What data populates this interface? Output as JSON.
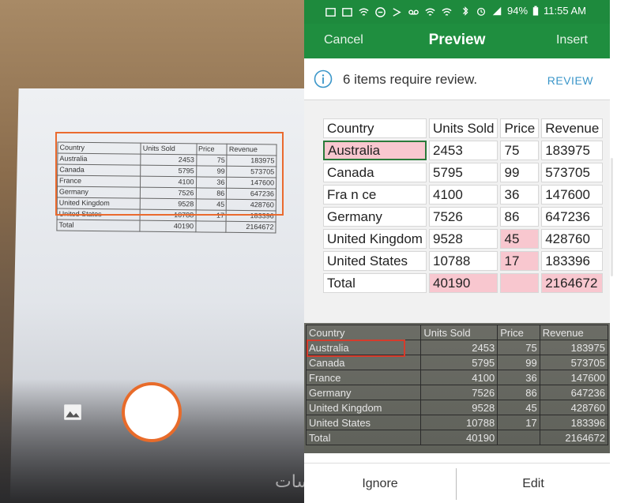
{
  "camera": {
    "paper_table": [
      [
        "Country",
        "Units Sold",
        "Price",
        "Revenue"
      ],
      [
        "Australia",
        "2453",
        "75",
        "183975"
      ],
      [
        "Canada",
        "5795",
        "99",
        "573705"
      ],
      [
        "France",
        "4100",
        "36",
        "147600"
      ],
      [
        "Germany",
        "7526",
        "86",
        "647236"
      ],
      [
        "United Kingdom",
        "9528",
        "45",
        "428760"
      ],
      [
        "United States",
        "10788",
        "17",
        "183396"
      ],
      [
        "Total",
        "40190",
        "",
        "2164672"
      ]
    ]
  },
  "status_bar": {
    "battery": "94%",
    "time": "11:55 AM"
  },
  "app_bar": {
    "cancel_label": "Cancel",
    "title": "Preview",
    "insert_label": "Insert"
  },
  "review": {
    "message": "6 items require review.",
    "action_label": "REVIEW"
  },
  "preview_grid": {
    "rows": [
      [
        "Country",
        "Units Sold",
        "Price",
        "Revenue"
      ],
      [
        "Australia",
        "2453",
        "75",
        "183975"
      ],
      [
        "Canada",
        "5795",
        "99",
        "573705"
      ],
      [
        "Fra n ce",
        "4100",
        "36",
        "147600"
      ],
      [
        "Germany",
        "7526",
        "86",
        "647236"
      ],
      [
        "United Kingdom",
        "9528",
        "45",
        "428760"
      ],
      [
        "United States",
        "10788",
        "17",
        "183396"
      ],
      [
        "Total",
        "40190",
        "",
        "2164672"
      ]
    ],
    "flagged_cells": [
      [
        1,
        0
      ],
      [
        5,
        2
      ],
      [
        6,
        2
      ],
      [
        7,
        1
      ],
      [
        7,
        2
      ],
      [
        7,
        3
      ]
    ],
    "selected_cell": [
      1,
      0
    ],
    "colors": {
      "flag": "#f8c7cf",
      "selected_border": "#2b7a3b"
    }
  },
  "photo_strip": {
    "rows": [
      [
        "Country",
        "Units Sold",
        "Price",
        "Revenue"
      ],
      [
        "Australia",
        "2453",
        "75",
        "183975"
      ],
      [
        "Canada",
        "5795",
        "99",
        "573705"
      ],
      [
        "France",
        "4100",
        "36",
        "147600"
      ],
      [
        "Germany",
        "7526",
        "86",
        "647236"
      ],
      [
        "United Kingdom",
        "9528",
        "45",
        "428760"
      ],
      [
        "United States",
        "10788",
        "17",
        "183396"
      ],
      [
        "Total",
        "40190",
        "",
        "2164672"
      ]
    ]
  },
  "actions": {
    "ignore_label": "Ignore",
    "edit_label": "Edit"
  },
  "watermark": "خمسات",
  "theme": {
    "brand_green": "#1f8e3f",
    "accent_orange": "#e86b2a",
    "link_blue": "#3a96c9"
  },
  "icons": {
    "gallery": "image-icon",
    "info": "info-icon",
    "shutter": "shutter-button"
  }
}
